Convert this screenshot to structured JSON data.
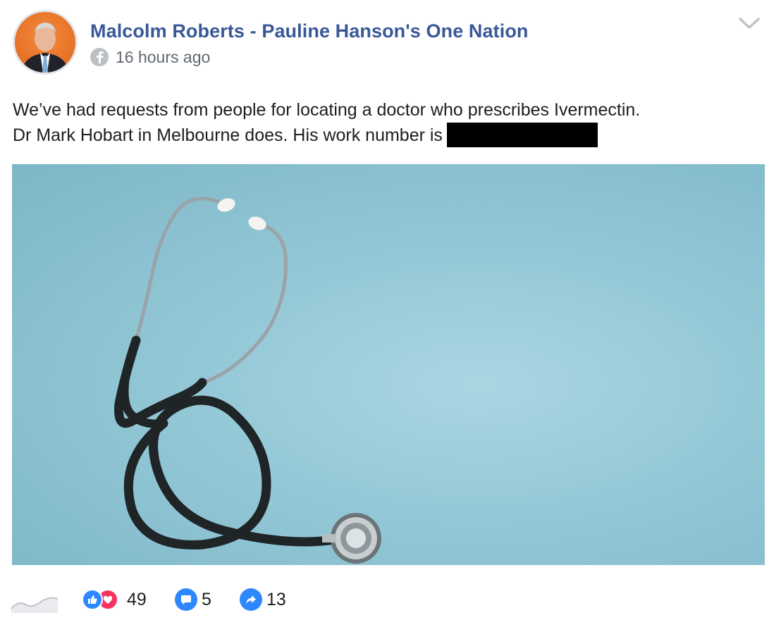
{
  "post": {
    "author": "Malcolm Roberts - Pauline Hanson's One Nation",
    "time": "16 hours ago",
    "message_line1": "We’ve had requests from people for locating a doctor who prescribes Ivermectin.",
    "message_line2": "Dr Mark Hobart in Melbourne does. His work number is",
    "image_subject": "stethoscope-photo"
  },
  "stats": {
    "reactions_count": "49",
    "comments_count": "5",
    "shares_count": "13"
  },
  "colors": {
    "author_link": "#385898",
    "accent_blue": "#2d88ff",
    "care_red": "#f5335f",
    "photo_background": "#93c7d6"
  },
  "icons": [
    "facebook-globe-icon",
    "chevron-down-icon",
    "trend-chart-icon",
    "like-icon",
    "care-icon",
    "comment-icon",
    "share-icon"
  ]
}
